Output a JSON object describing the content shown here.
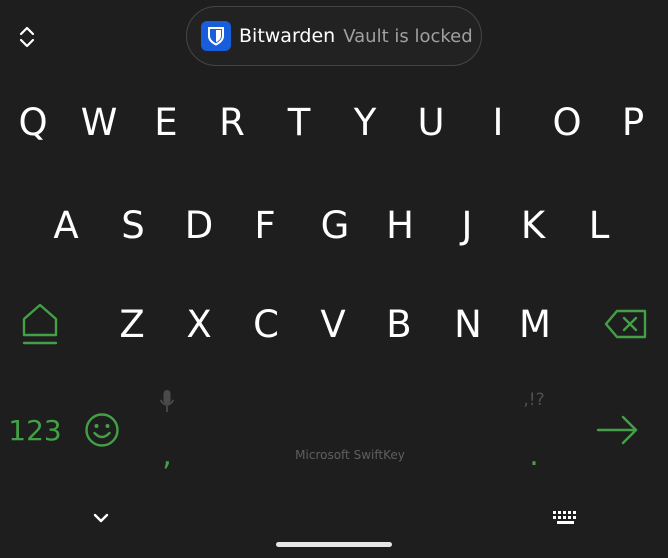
{
  "autofill": {
    "app_name": "Bitwarden",
    "status": "Vault is locked"
  },
  "keyboard": {
    "row1": [
      "Q",
      "W",
      "E",
      "R",
      "T",
      "Y",
      "U",
      "I",
      "O",
      "P"
    ],
    "row2": [
      "A",
      "S",
      "D",
      "F",
      "G",
      "H",
      "J",
      "K",
      "L"
    ],
    "row3": [
      "Z",
      "X",
      "C",
      "V",
      "B",
      "N",
      "M"
    ],
    "numbers_label": "123",
    "comma": ",",
    "period": ".",
    "punctuation_hint": ",!?",
    "brand": "Microsoft SwiftKey",
    "accent_color": "#43a047"
  },
  "icons": {
    "expand": "expand-collapse-icon",
    "shift": "shift-icon",
    "backspace": "backspace-icon",
    "emoji": "emoji-icon",
    "mic": "microphone-icon",
    "enter": "arrow-right-icon",
    "hide": "chevron-down-icon",
    "switch": "keyboard-icon"
  }
}
